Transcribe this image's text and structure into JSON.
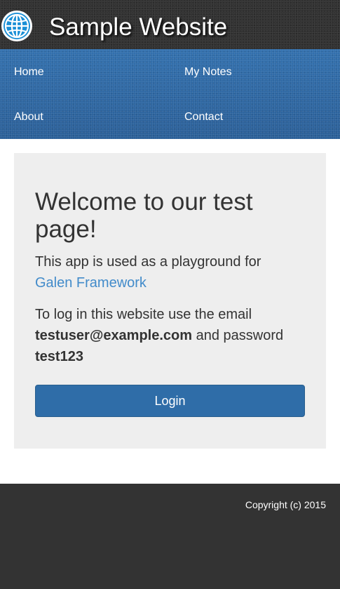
{
  "header": {
    "title": "Sample Website",
    "logo_icon": "globe-icon"
  },
  "nav": {
    "items": [
      {
        "label": "Home"
      },
      {
        "label": "My Notes"
      },
      {
        "label": "About"
      },
      {
        "label": "Contact"
      }
    ]
  },
  "welcome": {
    "heading": "Welcome to our test page!",
    "intro_text": "This app is used as a playground for",
    "framework_link": "Galen Framework",
    "login_text": "To log in this website use the email",
    "email": "testuser@example.com",
    "and_password": "and password",
    "password": "test123",
    "login_button": "Login"
  },
  "footer": {
    "copyright": "Copyright (c) 2015"
  },
  "colors": {
    "header_bg": "#333333",
    "nav_bg": "#2c64a0",
    "panel_bg": "#eeeeee",
    "link": "#428bca",
    "button_bg": "#2f6da8",
    "footer_bg": "#333333"
  }
}
